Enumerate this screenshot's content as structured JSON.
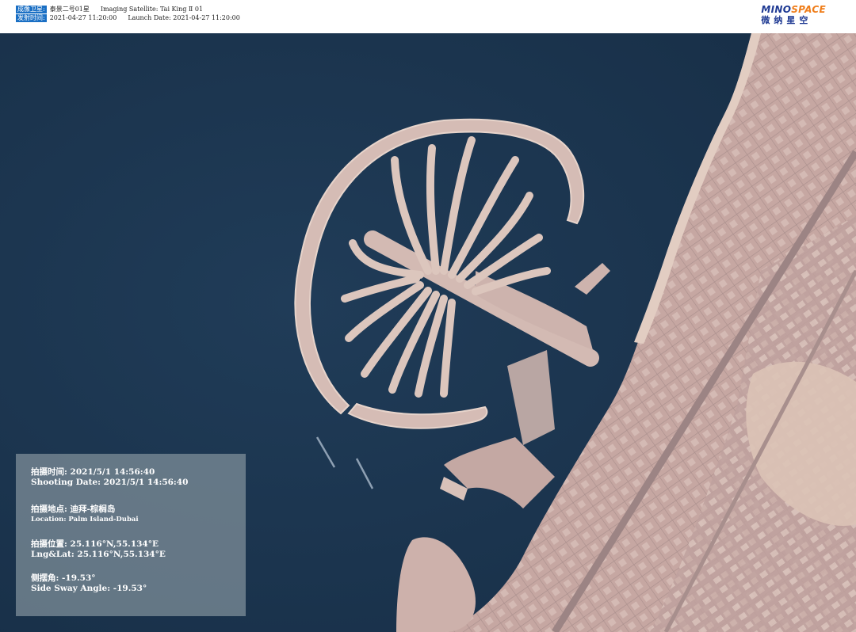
{
  "header": {
    "satellite_label": "成像卫星:",
    "satellite_value_cn": "泰景二号01星",
    "satellite_value_en": "Imaging Satellite: Tai King Ⅱ 01",
    "launch_label": "发射时间:",
    "launch_value_cn": "2021-04-27 11:20:00",
    "launch_value_en": "Launch Date: 2021-04-27 11:20:00"
  },
  "brand": {
    "name_en_part1": "MINO",
    "name_en_part2": "SPACE",
    "name_cn": "微纳星空",
    "colors": {
      "blue": "#1f3a93",
      "orange": "#ef7d1a"
    }
  },
  "info": {
    "shooting_cn": "拍摄时间: 2021/5/1 14:56:40",
    "shooting_en": "Shooting Date: 2021/5/1 14:56:40",
    "location_cn": "拍摄地点: 迪拜-棕榈岛",
    "location_en": "Location: Palm Island-Dubai",
    "position_cn": "拍摄位置: 25.116°N,55.134°E",
    "position_en": "Lng&Lat: 25.116°N,55.134°E",
    "sway_cn": "侧摆角: -19.53°",
    "sway_en": "Side Sway Angle: -19.53°"
  },
  "colors": {
    "sea": "#1c3550",
    "land": "#c7a9a3",
    "sand": "#dcc6bc",
    "label_bg": "#1a6fc4"
  }
}
